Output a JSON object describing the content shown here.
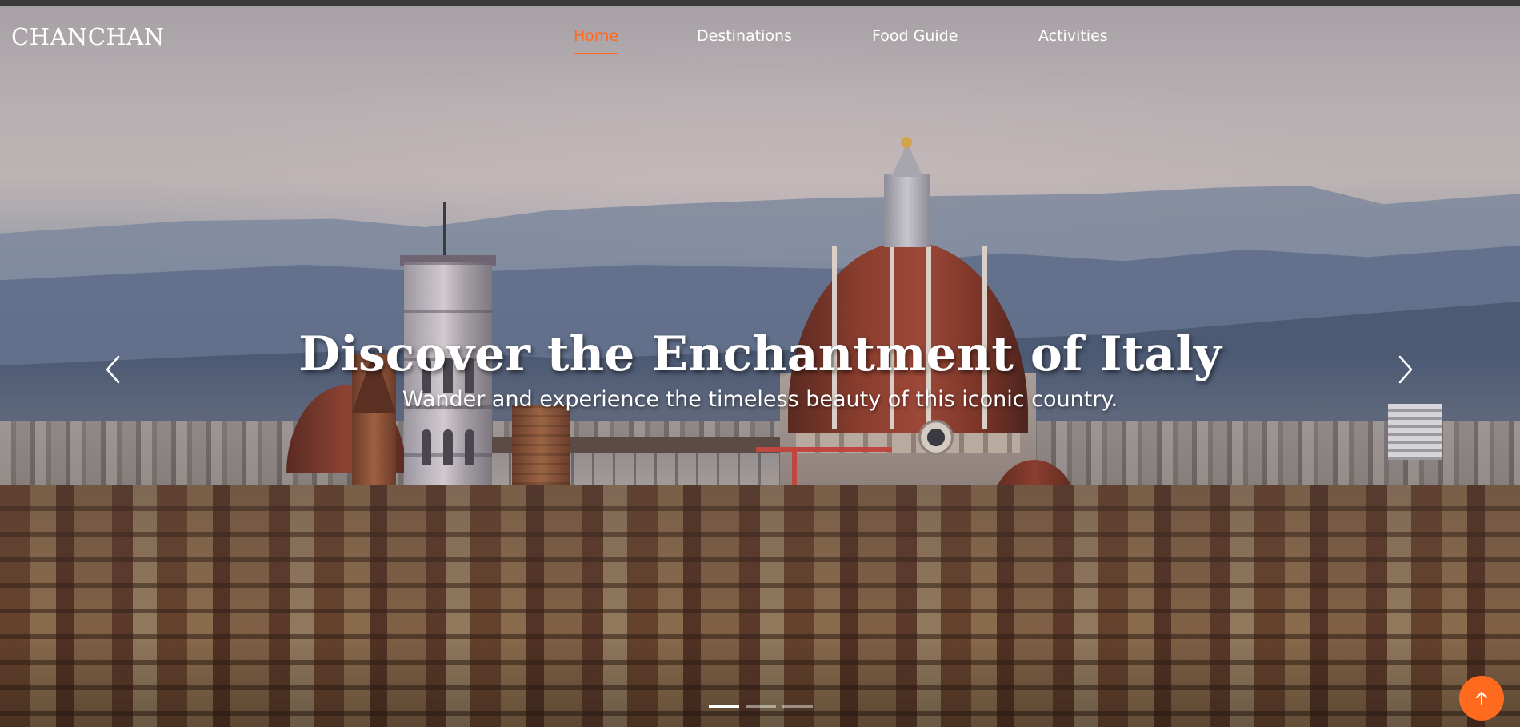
{
  "brand": {
    "name": "CHANCHAN"
  },
  "nav": {
    "items": [
      {
        "label": "Home",
        "active": true
      },
      {
        "label": "Destinations",
        "active": false
      },
      {
        "label": "Food Guide",
        "active": false
      },
      {
        "label": "Activities",
        "active": false
      }
    ]
  },
  "hero": {
    "title": "Discover the Enchantment of Italy",
    "subtitle": "Wander and experience the timeless beauty of this iconic country.",
    "image_subject": "Florence skyline with the cathedral dome at dusk",
    "slides_count": 3,
    "active_slide": 1,
    "prev_icon": "chevron-left-icon",
    "next_icon": "chevron-right-icon"
  },
  "back_to_top": {
    "icon": "arrow-up-icon"
  },
  "colors": {
    "accent": "#ff6a1f",
    "text": "#ffffff",
    "top_strip": "#3b3b3b"
  }
}
